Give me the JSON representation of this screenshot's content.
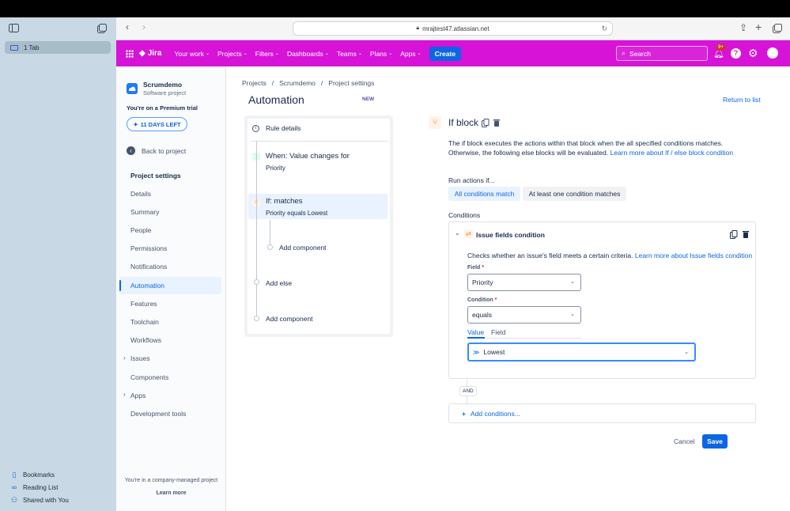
{
  "safari": {
    "tab_label": "1 Tab",
    "bookmarks": "Bookmarks",
    "reading_list": "Reading List",
    "shared_with_you": "Shared with You",
    "url": "mrajtest47.atlassian.net"
  },
  "nav": {
    "logo": "Jira",
    "items": [
      "Your work",
      "Projects",
      "Filters",
      "Dashboards",
      "Teams",
      "Plans",
      "Apps"
    ],
    "create": "Create",
    "search_placeholder": "Search",
    "notifications_badge": "9+"
  },
  "project": {
    "name": "Scrumdemo",
    "type": "Software project",
    "trial_text": "You're on a Premium trial",
    "trial_button": "11 DAYS LEFT",
    "back": "Back to project",
    "settings_heading": "Project settings",
    "menu": [
      "Details",
      "Summary",
      "People",
      "Permissions",
      "Notifications",
      "Automation",
      "Features",
      "Toolchain",
      "Workflows",
      "Issues",
      "Components",
      "Apps",
      "Development tools"
    ],
    "footer_text": "You're in a company-managed project",
    "footer_link": "Learn more"
  },
  "breadcrumb": {
    "items": [
      "Projects",
      "Scrumdemo",
      "Project settings"
    ],
    "separator": "/"
  },
  "page": {
    "title": "Automation",
    "new_badge": "NEW",
    "return_link": "Return to list"
  },
  "rule": {
    "details": "Rule details",
    "trigger_title": "When: Value changes for",
    "trigger_sub": "Priority",
    "if_title": "If: matches",
    "if_sub": "Priority equals Lowest",
    "add_component_inner": "Add component",
    "add_else": "Add else",
    "add_component": "Add component"
  },
  "editor": {
    "title": "If block",
    "description": "The if block executes the actions within that block when the all specified conditions matches. Otherwise, the following else blocks will be evaluated.",
    "learn_more": "Learn more about If / else block condition",
    "run_actions_label": "Run actions if...",
    "run_options": [
      "All conditions match",
      "At least one condition matches"
    ],
    "conditions_label": "Conditions",
    "condition_title": "Issue fields condition",
    "condition_desc": "Checks whether an issue's field meets a certain criteria.",
    "condition_learn_more": "Learn more about Issue fields condition",
    "field_label": "Field",
    "field_value": "Priority",
    "condition_label": "Condition",
    "condition_value": "equals",
    "tabs": [
      "Value",
      "Field"
    ],
    "value_selected": "Lowest",
    "and_label": "AND",
    "add_conditions": "Add conditions...",
    "cancel": "Cancel",
    "save": "Save"
  },
  "colors": {
    "nav_bg": "#d613d7",
    "primary": "#0c66e4",
    "if_icon": "#f18d13"
  }
}
